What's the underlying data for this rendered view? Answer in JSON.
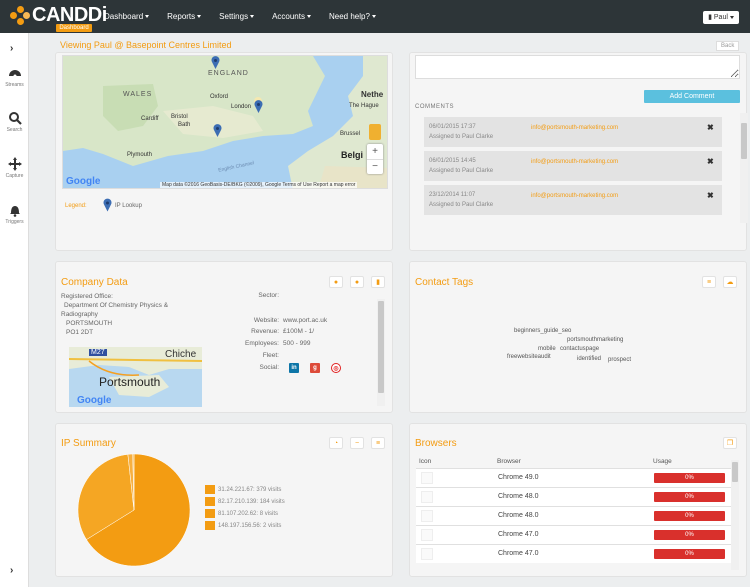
{
  "app": {
    "logo_text": "CANDDi",
    "logo_sub": "Dashboard"
  },
  "nav": {
    "items": [
      {
        "label": "Dashboard"
      },
      {
        "label": "Reports"
      },
      {
        "label": "Settings"
      },
      {
        "label": "Accounts"
      },
      {
        "label": "Need help?"
      }
    ],
    "user_label": "Paul"
  },
  "sidebar": {
    "items": [
      {
        "label": "Streams",
        "icon": "dashboard-icon"
      },
      {
        "label": "Search",
        "icon": "search-icon"
      },
      {
        "label": "Capture",
        "icon": "crosshair-icon"
      },
      {
        "label": "Triggers",
        "icon": "bell-icon"
      }
    ]
  },
  "page": {
    "breadcrumb": "Viewing Paul @ Basepoint Centres Limited",
    "back_label": "Back"
  },
  "map_panel": {
    "places": [
      "ENGLAND",
      "WALES",
      "Netherlands",
      "London",
      "Oxford",
      "Cardiff",
      "Bath",
      "Bristol",
      "Plymouth",
      "The Hague",
      "Brussels",
      "Belgium",
      "English Channel"
    ],
    "place_labels": {
      "england": "ENGLAND",
      "wales": "WALES",
      "neth": "Nethe",
      "london": "London",
      "oxford": "Oxford",
      "cardiff": "Cardiff",
      "bath": "Bath",
      "bristol": "Bristol",
      "plymouth": "Plymouth",
      "hague": "The Hague",
      "brussels": "Brussel",
      "belg": "Belgi",
      "channel": "English Channel"
    },
    "attribution": "Map data ©2016 GeoBasis-DE/BKG (©2009), Google   Terms of Use   Report a map error",
    "google": "Google",
    "legend_label": "Legend:",
    "legend_item": "IP Lookup",
    "zoom_in": "+",
    "zoom_out": "−"
  },
  "comments_panel": {
    "add_label": "Add Comment",
    "heading": "COMMENTS",
    "items": [
      {
        "date": "06/01/2015 17:37",
        "assigned": "Assigned to Paul Clarke",
        "email": "info@portsmouth-marketing.com"
      },
      {
        "date": "06/01/2015 14:45",
        "assigned": "Assigned to Paul Clarke",
        "email": "info@portsmouth-marketing.com"
      },
      {
        "date": "23/12/2014 11:07",
        "assigned": "Assigned to Paul Clarke",
        "email": "info@portsmouth-marketing.com"
      }
    ]
  },
  "company_panel": {
    "title": "Company Data",
    "registered_label": "Registered Office:",
    "address_lines": [
      "Department Of Chemistry Physics &",
      "Radiography",
      "PORTSMOUTH",
      "PO1 2DT"
    ],
    "sector_label": "Sector:",
    "fields": [
      {
        "label": "Website:",
        "value": "www.port.ac.uk"
      },
      {
        "label": "Revenue:",
        "value": "£100M - 1/"
      },
      {
        "label": "Employees:",
        "value": "500 - 999"
      },
      {
        "label": "Fleet:",
        "value": ""
      },
      {
        "label": "Social:",
        "value": ""
      }
    ],
    "map_labels": {
      "road": "M27",
      "city": "Portsmouth",
      "chich": "Chiche",
      "google": "Google"
    }
  },
  "tags_panel": {
    "title": "Contact Tags",
    "tags": [
      "beginners_guide_seo",
      "portsmouthmarketing",
      "mobile",
      "contactuspage",
      "freewebsiteaudit",
      "identified",
      "prospect"
    ]
  },
  "ip_panel": {
    "title": "IP Summary",
    "entries": [
      {
        "label": "31.24.221.67: 379 visits",
        "visits": 379
      },
      {
        "label": "82.17.210.139: 184 visits",
        "visits": 184
      },
      {
        "label": "81.107.202.62: 8 visits",
        "visits": 8
      },
      {
        "label": "148.197.156.56: 2 visits",
        "visits": 2
      }
    ]
  },
  "browsers_panel": {
    "title": "Browsers",
    "headers": {
      "icon": "Icon",
      "browser": "Browser",
      "usage": "Usage"
    },
    "rows": [
      {
        "browser": "Chrome 49.0",
        "usage": "0%"
      },
      {
        "browser": "Chrome 48.0",
        "usage": "0%"
      },
      {
        "browser": "Chrome 48.0",
        "usage": "0%"
      },
      {
        "browser": "Chrome 47.0",
        "usage": "0%"
      },
      {
        "browser": "Chrome 47.0",
        "usage": "0%"
      }
    ]
  },
  "colors": {
    "accent": "#f39c12",
    "topbar": "#2d3538",
    "button_info": "#5bc0de",
    "danger": "#d9302c"
  }
}
